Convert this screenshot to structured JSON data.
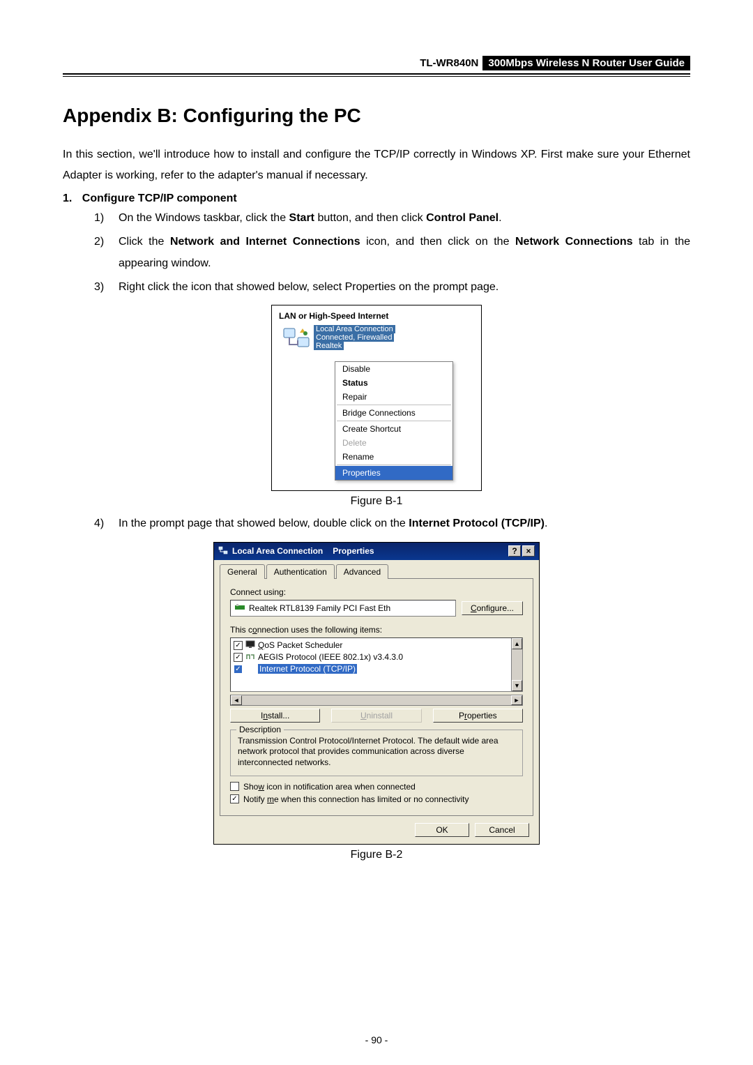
{
  "header": {
    "model": "TL-WR840N",
    "title": "300Mbps Wireless N Router User Guide"
  },
  "title": "Appendix B: Configuring the PC",
  "intro": "In this section, we'll introduce how to install and configure the TCP/IP correctly in Windows XP. First make sure your Ethernet Adapter is working, refer to the adapter's manual if necessary.",
  "list_heading_number": "1.",
  "list_heading": "Configure TCP/IP component",
  "steps": {
    "s1_a": "On the Windows taskbar, click the ",
    "s1_b": "Start",
    "s1_c": " button, and then click ",
    "s1_d": "Control Panel",
    "s1_e": ".",
    "s2_a": "Click the ",
    "s2_b": "Network and Internet Connections",
    "s2_c": " icon, and then click on the ",
    "s2_d": "Network Connections",
    "s2_e": " tab in the appearing window.",
    "s3": "Right click the icon that showed below, select Properties on the prompt page.",
    "s4_a": "In the prompt page that showed below, double click on the ",
    "s4_b": "Internet Protocol (TCP/IP)",
    "s4_c": "."
  },
  "fig1": {
    "caption": "Figure B-1",
    "group_title": "LAN or High-Speed Internet",
    "conn_line1": "Local Area Connection",
    "conn_line2": "Connected, Firewalled",
    "conn_line3": "Realtek",
    "menu": {
      "disable": "Disable",
      "status": "Status",
      "repair": "Repair",
      "bridge": "Bridge Connections",
      "shortcut": "Create Shortcut",
      "delete": "Delete",
      "rename": "Rename",
      "properties": "Properties"
    }
  },
  "fig2": {
    "caption": "Figure B-2",
    "title_a": "Local Area Connection",
    "title_b": "Properties",
    "help_btn": "?",
    "close_btn": "×",
    "tabs": {
      "general": "General",
      "auth": "Authentication",
      "adv": "Advanced"
    },
    "connect_label": "Connect using:",
    "adapter": "Realtek RTL8139 Family PCI Fast Eth",
    "configure_btn": "Configure...",
    "items_label": "This connection uses the following items:",
    "items": {
      "qos": "QoS Packet Scheduler",
      "aegis": "AEGIS Protocol (IEEE 802.1x) v3.4.3.0",
      "tcpip": "Internet Protocol (TCP/IP)"
    },
    "install_btn": "Install...",
    "uninstall_btn": "Uninstall",
    "properties_btn": "Properties",
    "desc_title": "Description",
    "desc_text": "Transmission Control Protocol/Internet Protocol. The default wide area network protocol that provides communication across diverse interconnected networks.",
    "show_icon": "Show icon in notification area when connected",
    "notify": "Notify me when this connection has limited or no connectivity",
    "ok": "OK",
    "cancel": "Cancel"
  },
  "page_number": "- 90 -"
}
